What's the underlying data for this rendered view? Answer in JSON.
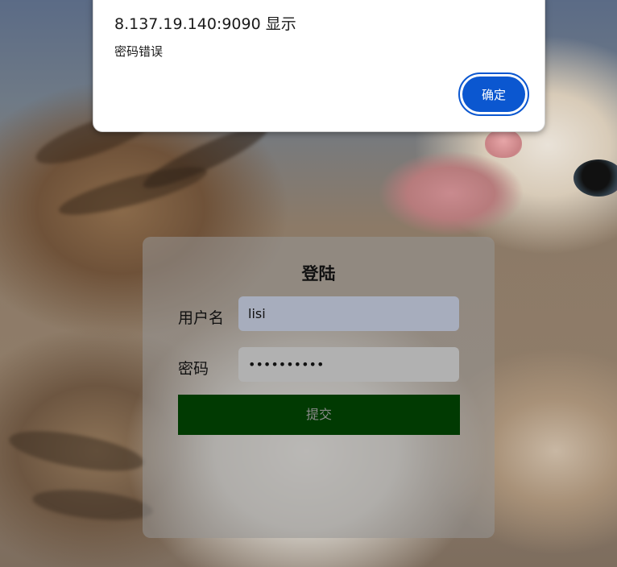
{
  "dialog": {
    "title": "8.137.19.140:9090 显示",
    "message": "密码错误",
    "ok_label": "确定"
  },
  "login": {
    "title": "登陆",
    "username_label": "用户名",
    "username_value": "lisi",
    "password_label": "密码",
    "password_masked": "••••••••••",
    "submit_label": "提交"
  },
  "colors": {
    "submit_bg": "#013a02",
    "dialog_button": "#0b57d0"
  }
}
